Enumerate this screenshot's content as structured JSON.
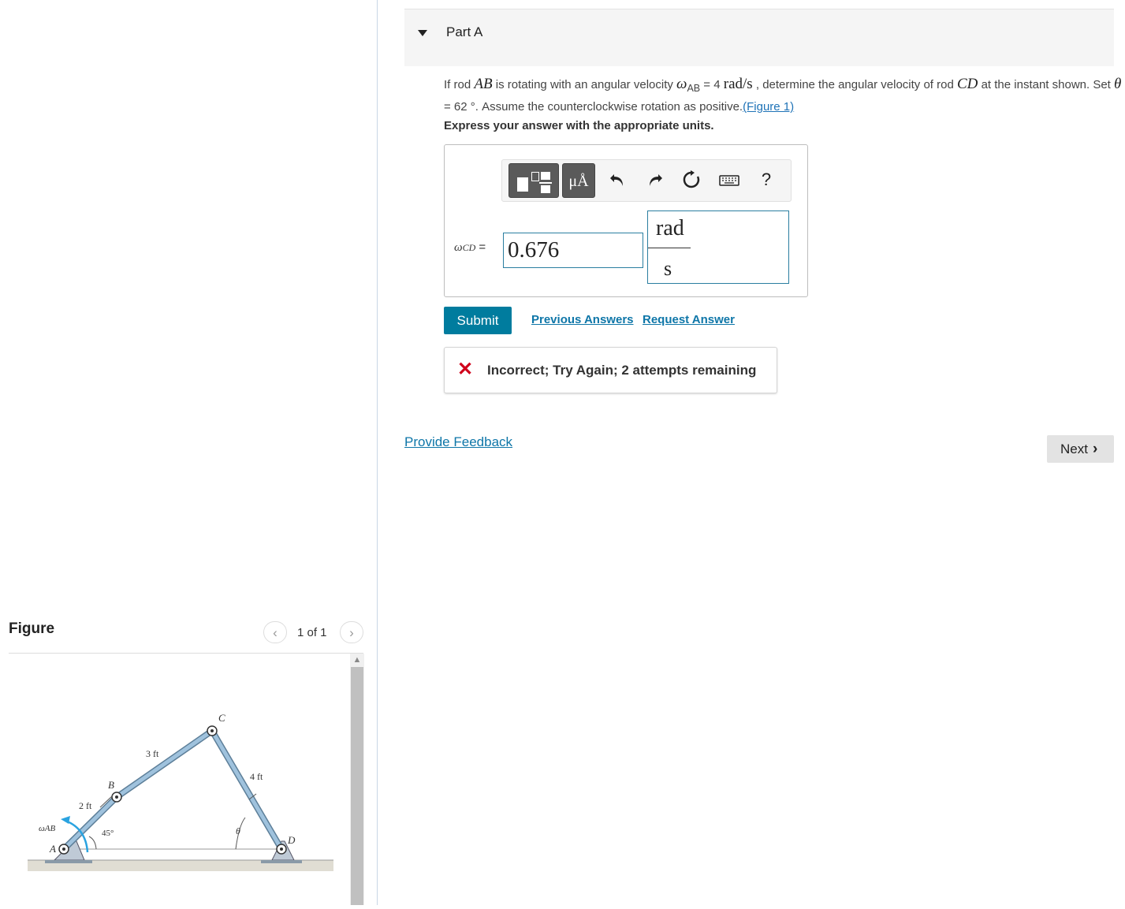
{
  "part": {
    "title": "Part A"
  },
  "question": {
    "t1": "If rod ",
    "ab": "AB",
    "t2": " is rotating with an angular velocity ",
    "omega_ab_sym": "ω",
    "omega_ab_sub": "AB",
    "t3": " = 4 ",
    "units": "rad/s",
    "t4": " , determine the angular velocity of rod ",
    "cd": "CD",
    "t5": " at the instant shown. Set ",
    "theta": "θ",
    "t6": " = 62 °. Assume the counterclockwise rotation as positive.",
    "figure_link": "(Figure 1)",
    "express": "Express your answer with the appropriate units."
  },
  "toolbar": {
    "units_label": "μÅ",
    "help_label": "?"
  },
  "answer": {
    "label_sym": "ω",
    "label_sub": "CD",
    "label_eq": " =",
    "value": "0.676",
    "unit_num": "rad",
    "unit_den": "s"
  },
  "actions": {
    "submit": "Submit",
    "previous_answers": "Previous Answers",
    "request_answer": "Request Answer"
  },
  "feedback": {
    "message": "Incorrect; Try Again; 2 attempts remaining"
  },
  "footer": {
    "provide_feedback": "Provide Feedback",
    "next": "Next"
  },
  "figure": {
    "title": "Figure",
    "pager": "1 of 1",
    "labels": {
      "c": "C",
      "b": "B",
      "a": "A",
      "d": "D",
      "ab_len": "2 ft",
      "bc_len": "3 ft",
      "cd_len": "4 ft",
      "angle": "45°",
      "theta": "θ",
      "omega": "ωAB"
    }
  },
  "colors": {
    "accent": "#007c9e",
    "link": "#0e76a8",
    "error": "#d0021b",
    "rod": "#8fb3cf"
  }
}
